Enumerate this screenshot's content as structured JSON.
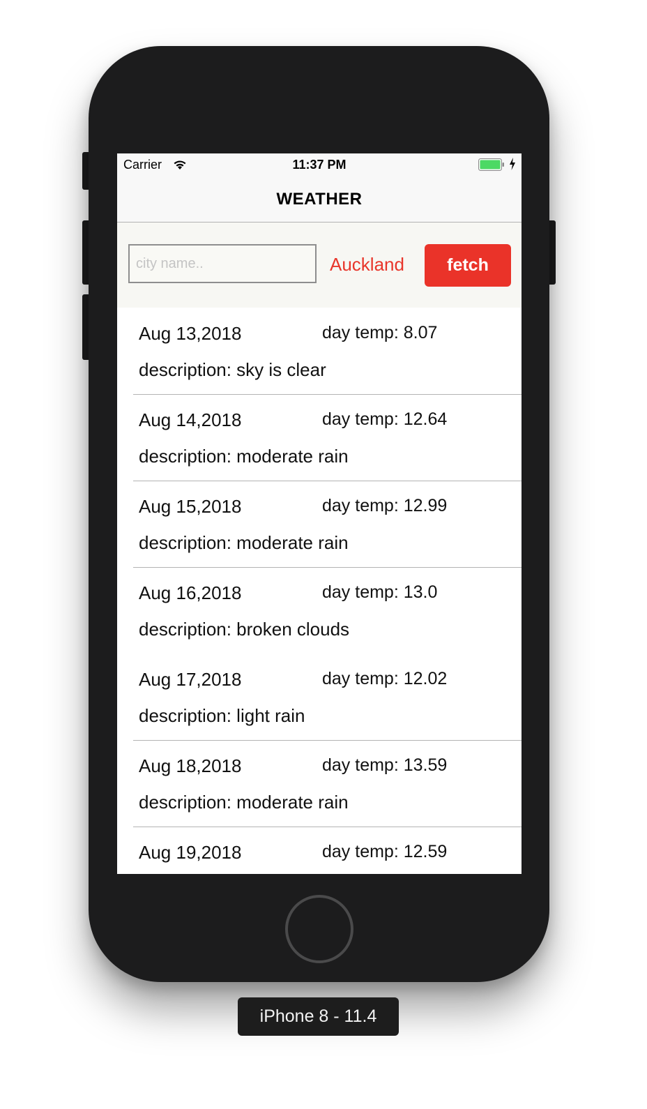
{
  "status_bar": {
    "carrier": "Carrier",
    "time": "11:37 PM",
    "battery_color": "#4cd964"
  },
  "nav": {
    "title": "WEATHER"
  },
  "search": {
    "placeholder": "city name..",
    "value": "",
    "city": "Auckland",
    "fetch_label": "fetch",
    "accent_color": "#ea3329"
  },
  "forecast": [
    {
      "date": "Aug 13,2018",
      "temp": "day temp: 8.07",
      "desc": "description: sky is clear"
    },
    {
      "date": "Aug 14,2018",
      "temp": "day temp: 12.64",
      "desc": "description: moderate rain"
    },
    {
      "date": "Aug 15,2018",
      "temp": "day temp: 12.99",
      "desc": "description: moderate rain"
    },
    {
      "date": "Aug 16,2018",
      "temp": "day temp: 13.0",
      "desc": "description: broken clouds"
    },
    {
      "date": "Aug 17,2018",
      "temp": "day temp: 12.02",
      "desc": "description: light rain"
    },
    {
      "date": "Aug 18,2018",
      "temp": "day temp: 13.59",
      "desc": "description: moderate rain"
    },
    {
      "date": "Aug 19,2018",
      "temp": "day temp: 12.59",
      "desc": ""
    }
  ],
  "device_label": "iPhone 8 - 11.4"
}
